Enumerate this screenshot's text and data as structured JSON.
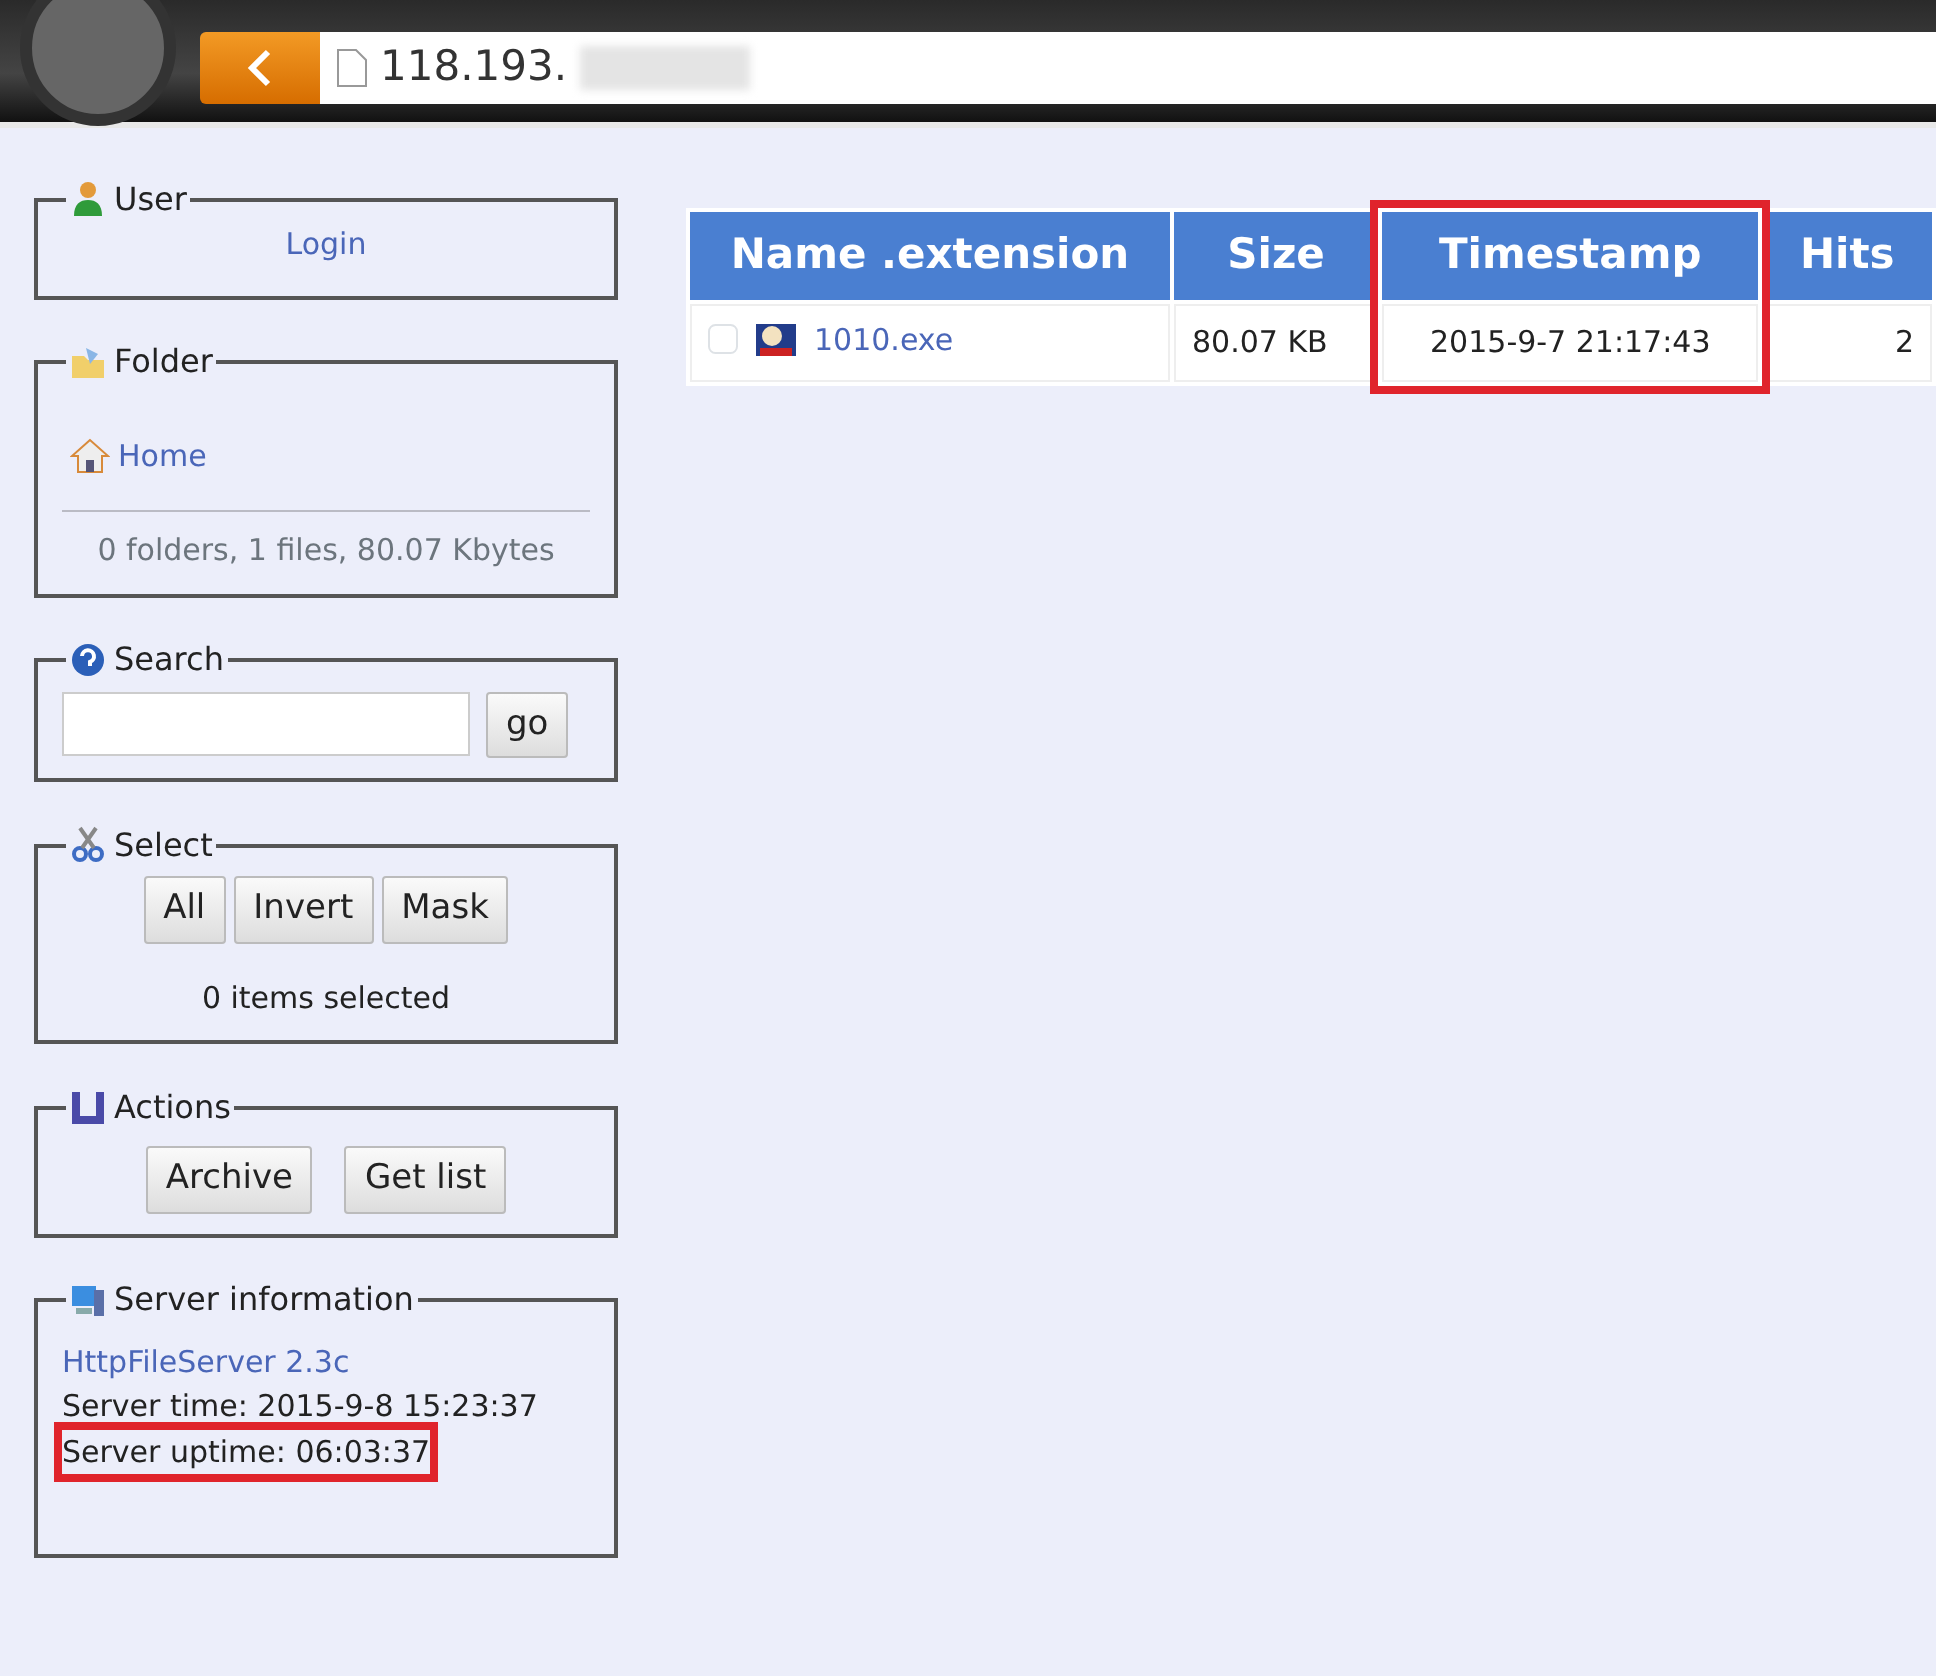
{
  "browser": {
    "address": "118.193.",
    "address_redacted": true
  },
  "panels": [
    {
      "kind": "user",
      "title": "User",
      "link": "Login"
    },
    {
      "kind": "folder",
      "title": "Folder",
      "link": "Home",
      "summary": "0 folders, 1 files, 80.07 Kbytes"
    },
    {
      "kind": "search",
      "title": "Search",
      "button": "go"
    },
    {
      "kind": "select",
      "title": "Select",
      "buttons": [
        "All",
        "Invert",
        "Mask"
      ],
      "summary": "0 items selected"
    },
    {
      "kind": "actions",
      "title": "Actions",
      "buttons": [
        "Archive",
        "Get list"
      ]
    },
    {
      "kind": "server",
      "title": "Server information",
      "link": "HttpFileServer 2.3c",
      "lines": [
        {
          "text": "Server time: 2015-9-8 15:23:37",
          "highlighted": false
        },
        {
          "text": "Server uptime: 06:03:37",
          "highlighted": true
        }
      ]
    }
  ],
  "table": {
    "columns": [
      {
        "label": "Name .extension",
        "highlighted": false
      },
      {
        "label": "Size",
        "highlighted": false
      },
      {
        "label": "Timestamp",
        "highlighted": true
      },
      {
        "label": "Hits",
        "highlighted": false
      }
    ],
    "rows": [
      {
        "checked": false,
        "name": "1010.exe",
        "size": "80.07 KB",
        "timestamp": "2015-9-7 21:17:43",
        "hits": "2"
      }
    ]
  }
}
